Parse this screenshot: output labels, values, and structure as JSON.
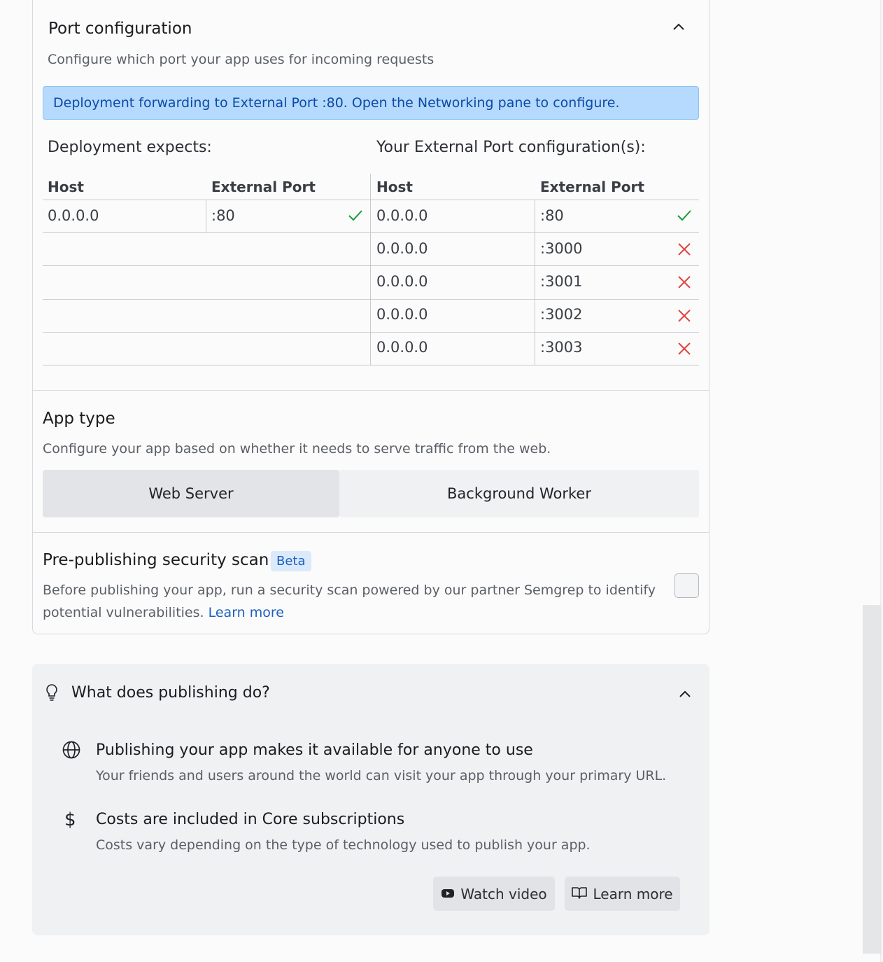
{
  "port_config": {
    "title": "Port configuration",
    "description": "Configure which port your app uses for incoming requests",
    "banner": "Deployment forwarding to External Port :80. Open the Networking pane to configure.",
    "deployment_expects_label": "Deployment expects:",
    "external_config_label": "Your External Port configuration(s):",
    "headers": {
      "host": "Host",
      "external_port": "External Port"
    },
    "expected_rows": [
      {
        "host": "0.0.0.0",
        "port": ":80",
        "status": "ok"
      }
    ],
    "external_rows": [
      {
        "host": "0.0.0.0",
        "port": ":80",
        "status": "ok"
      },
      {
        "host": "0.0.0.0",
        "port": ":3000",
        "status": "error"
      },
      {
        "host": "0.0.0.0",
        "port": ":3001",
        "status": "error"
      },
      {
        "host": "0.0.0.0",
        "port": ":3002",
        "status": "error"
      },
      {
        "host": "0.0.0.0",
        "port": ":3003",
        "status": "error"
      }
    ]
  },
  "app_type": {
    "title": "App type",
    "description": "Configure your app based on whether it needs to serve traffic from the web.",
    "options": [
      "Web Server",
      "Background Worker"
    ],
    "selected": "Web Server"
  },
  "security_scan": {
    "title": "Pre-publishing security scan",
    "badge": "Beta",
    "description": "Before publishing your app, run a security scan powered by our partner Semgrep to identify",
    "description_line2": "potential vulnerabilities.",
    "learn_more": "Learn more",
    "checked": false
  },
  "publishing_info": {
    "title": "What does publishing do?",
    "items": [
      {
        "icon": "globe-icon",
        "title": "Publishing your app makes it available for anyone to use",
        "text": "Your friends and users around the world can visit your app through your primary URL."
      },
      {
        "icon": "dollar-icon",
        "title": "Costs are included in Core subscriptions",
        "text": "Costs vary depending on the type of technology used to publish your app."
      }
    ],
    "buttons": {
      "watch_video": "Watch video",
      "learn_more": "Learn more"
    }
  },
  "colors": {
    "ok": "#1a9c3b",
    "error": "#e0463f",
    "banner_bg": "#b5dafd",
    "link": "#1b5fbf"
  }
}
